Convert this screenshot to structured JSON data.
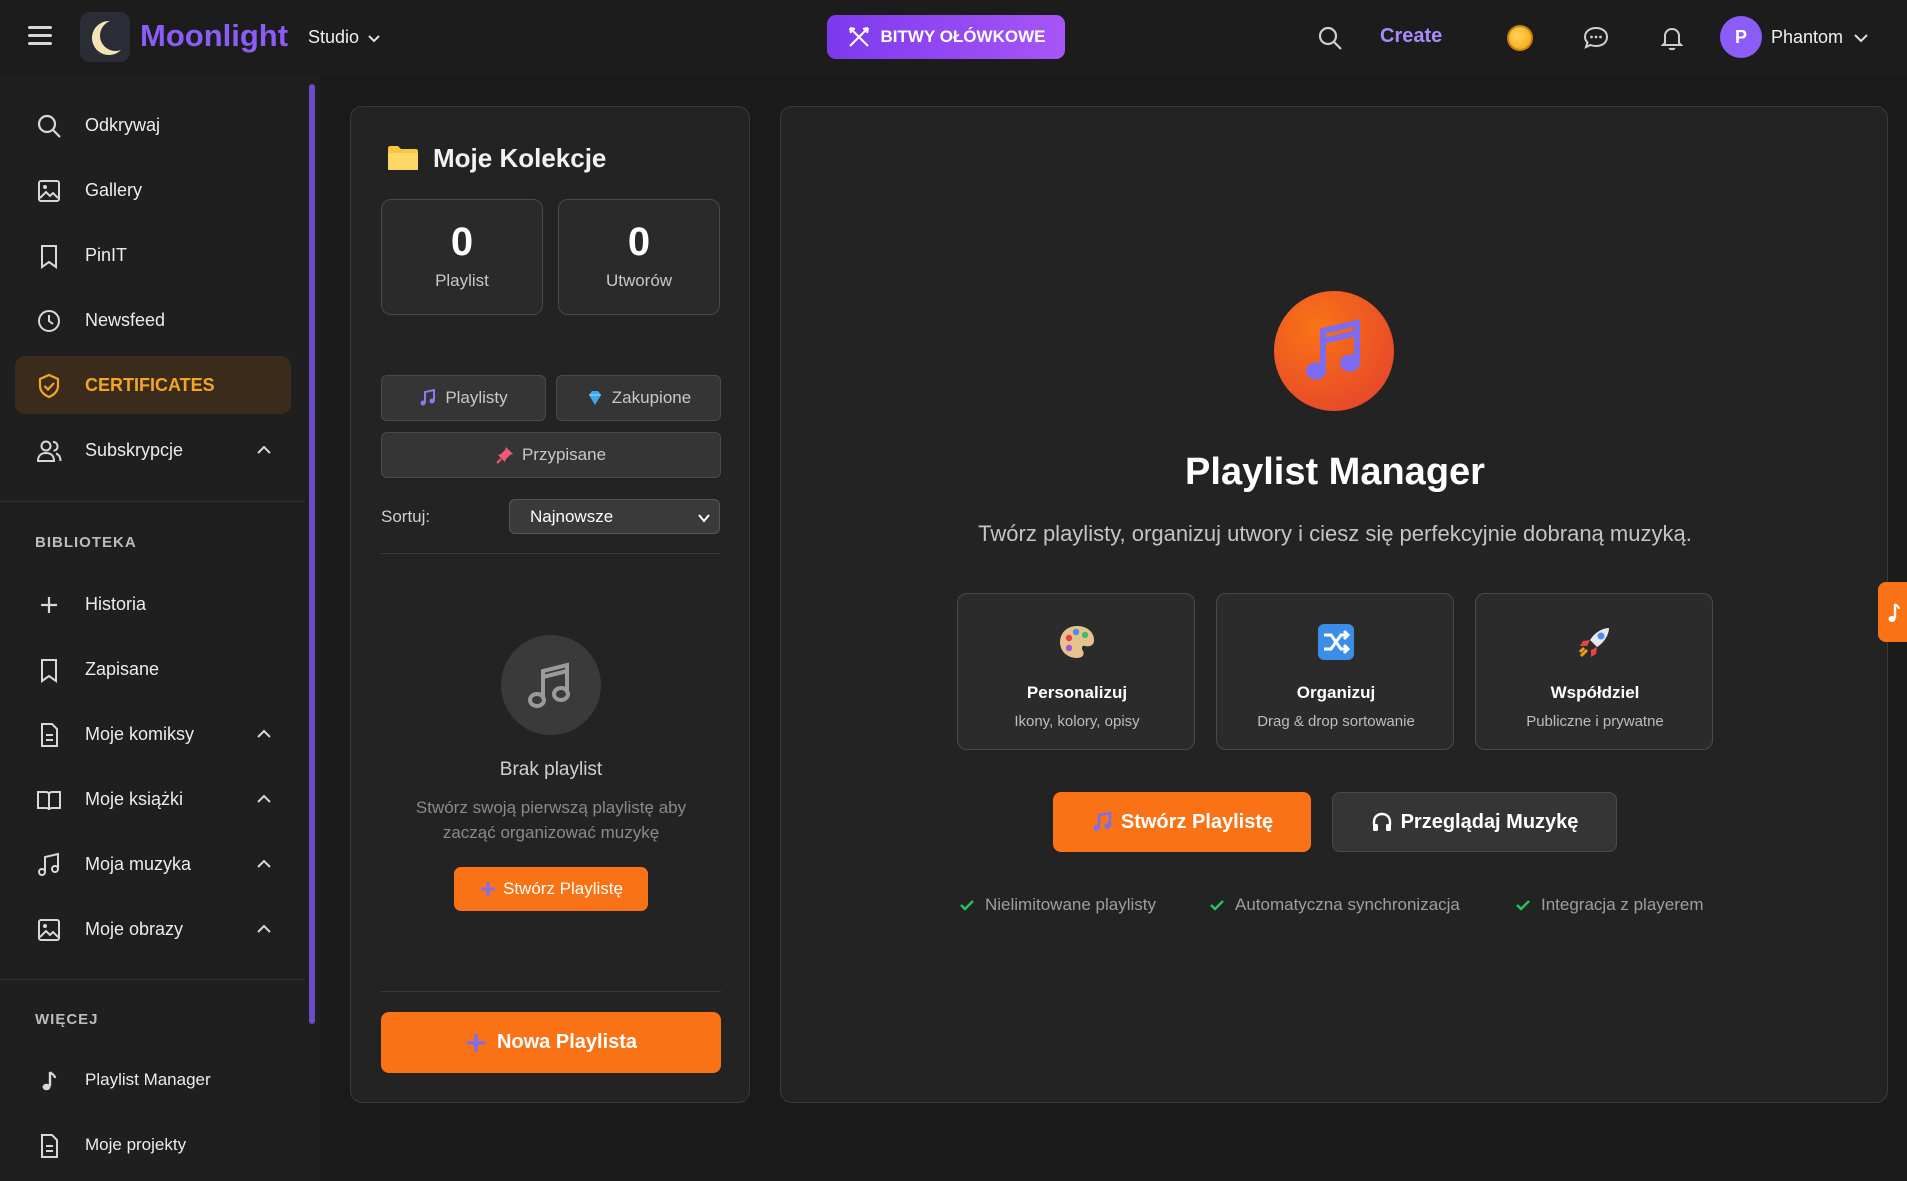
{
  "app": {
    "name": "Moonlight",
    "studio_label": "Studio"
  },
  "header": {
    "battle_label": "BITWY OŁÓWKOWE",
    "create_label": "Create",
    "user_initial": "P",
    "user_name": "Phantom"
  },
  "sidebar": {
    "items": [
      {
        "label": "Odkrywaj",
        "icon": "search-icon"
      },
      {
        "label": "Gallery",
        "icon": "image-icon"
      },
      {
        "label": "PinIT",
        "icon": "bookmark-icon"
      },
      {
        "label": "Newsfeed",
        "icon": "clock-icon"
      },
      {
        "label": "CERTIFICATES",
        "icon": "shield-check-icon",
        "active": true
      },
      {
        "label": "Subskrypcje",
        "icon": "users-icon",
        "expandable": true
      }
    ],
    "library_title": "BIBLIOTEKA",
    "library_items": [
      {
        "label": "Historia",
        "icon": "plus-icon"
      },
      {
        "label": "Zapisane",
        "icon": "bookmark-icon"
      },
      {
        "label": "Moje komiksy",
        "icon": "document-icon",
        "expandable": true
      },
      {
        "label": "Moje książki",
        "icon": "book-icon",
        "expandable": true
      },
      {
        "label": "Moja muzyka",
        "icon": "music-icon",
        "expandable": true
      },
      {
        "label": "Moje obrazy",
        "icon": "image-icon",
        "expandable": true
      }
    ],
    "more_title": "WIĘCEJ",
    "more_items": [
      {
        "label": "Playlist Manager",
        "icon": "music-note-icon"
      },
      {
        "label": "Moje projekty",
        "icon": "document-icon"
      }
    ]
  },
  "collections": {
    "title": "Moje Kolekcje",
    "stats": [
      {
        "value": "0",
        "label": "Playlist"
      },
      {
        "value": "0",
        "label": "Utworów"
      }
    ],
    "filters": [
      "Playlisty",
      "Zakupione",
      "Przypisane"
    ],
    "sort_label": "Sortuj:",
    "sort_value": "Najnowsze",
    "empty_title": "Brak playlist",
    "empty_desc": "Stwórz swoją pierwszą playlistę aby zacząć organizować muzykę",
    "empty_button": "Stwórz Playlistę",
    "new_button": "Nowa Playlista"
  },
  "main": {
    "title": "Playlist Manager",
    "subtitle": "Twórz playlisty, organizuj utwory i ciesz się perfekcyjnie dobraną muzyką.",
    "features": [
      {
        "title": "Personalizuj",
        "desc": "Ikony, kolory, opisy",
        "icon": "palette-icon"
      },
      {
        "title": "Organizuj",
        "desc": "Drag & drop sortowanie",
        "icon": "shuffle-icon"
      },
      {
        "title": "Współdziel",
        "desc": "Publiczne i prywatne",
        "icon": "rocket-icon"
      }
    ],
    "primary_button": "Stwórz Playlistę",
    "secondary_button": "Przeglądaj Muzykę",
    "checks": [
      "Nielimitowane playlisty",
      "Automatyczna synchronizacja",
      "Integracja z playerem"
    ]
  },
  "colors": {
    "accent": "#f97316",
    "brand": "#8b5cf6",
    "active": "#f5a524"
  }
}
